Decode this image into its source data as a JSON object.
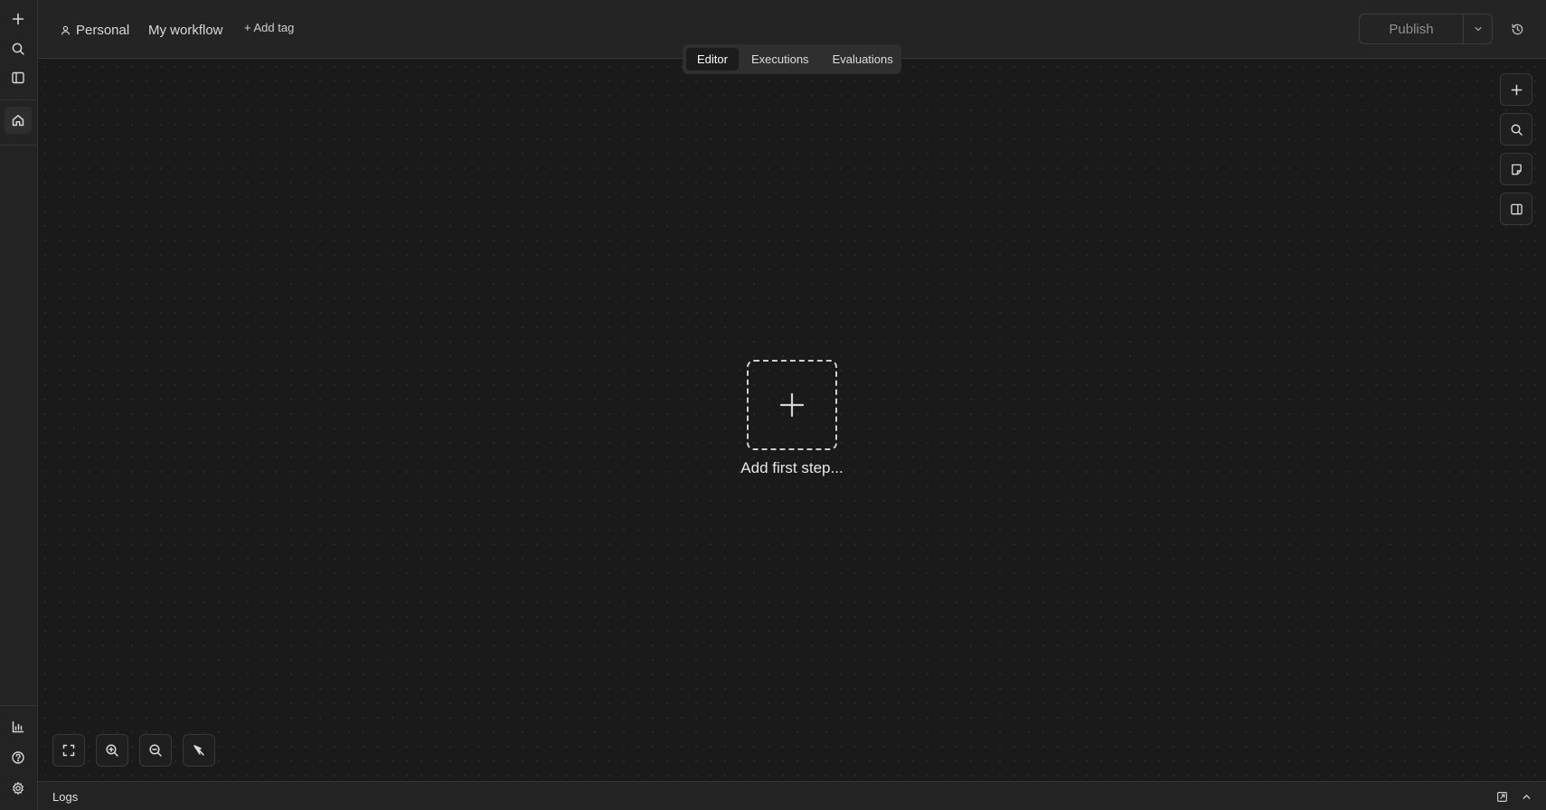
{
  "rail": {
    "top_icons": [
      "plus-icon",
      "search-icon",
      "sidebar-toggle-icon",
      "home-icon"
    ],
    "bottom_icons": [
      "insights-icon",
      "help-icon",
      "settings-icon"
    ]
  },
  "header": {
    "project": "Personal",
    "workflow_name": "My workflow",
    "add_tag": "+ Add tag",
    "publish_label": "Publish"
  },
  "tabs": [
    {
      "label": "Editor",
      "active": true
    },
    {
      "label": "Executions",
      "active": false
    },
    {
      "label": "Evaluations",
      "active": false
    }
  ],
  "canvas": {
    "add_first_step_label": "Add first step..."
  },
  "logs": {
    "label": "Logs"
  },
  "colors": {
    "background": "#1a1a1a",
    "panel": "#242424",
    "border": "#343434"
  }
}
